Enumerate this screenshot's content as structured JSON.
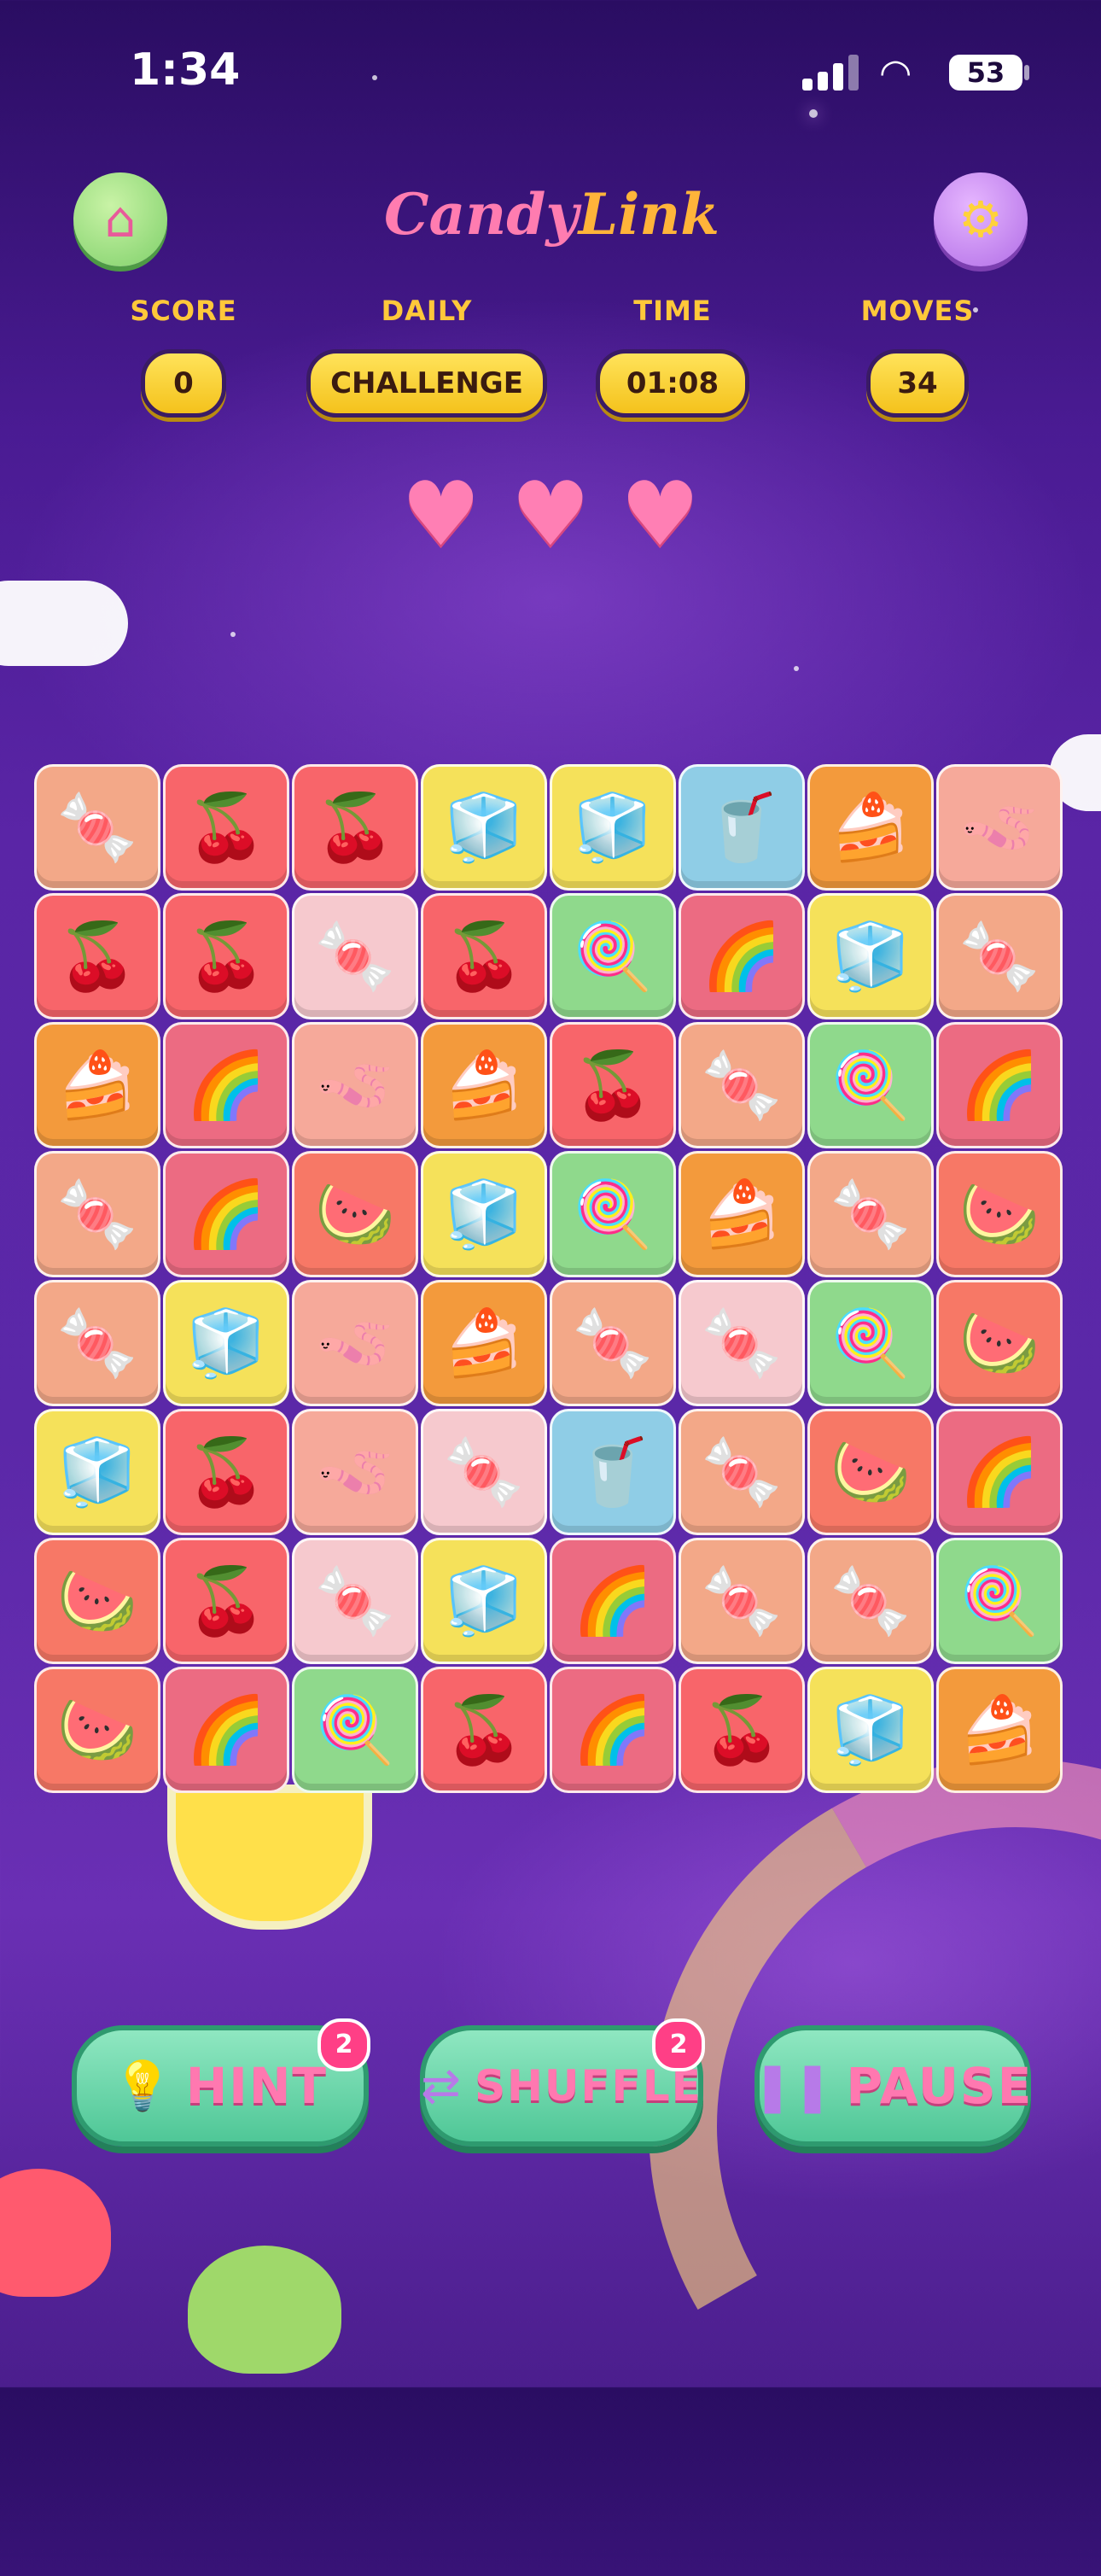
{
  "status_bar": {
    "time": "1:34",
    "battery": "53"
  },
  "header": {
    "logo_part1": "Candy",
    "logo_part2": "Link",
    "home_icon": "house-icon",
    "settings_icon": "gear-icon"
  },
  "stats": {
    "score_label": "SCORE",
    "score_value": "0",
    "daily_label": "DAILY",
    "daily_value": "CHALLENGE",
    "time_label": "TIME",
    "time_value": "01:08",
    "moves_label": "MOVES",
    "moves_value": "34"
  },
  "lives": 3,
  "board": {
    "columns": 8,
    "rows": [
      [
        "macaron",
        "cherry",
        "cherry",
        "jelly",
        "jelly",
        "cola",
        "cake",
        "worm"
      ],
      [
        "cherry",
        "cherry",
        "candy",
        "cherry",
        "cane",
        "rainbow",
        "jelly",
        "macaron"
      ],
      [
        "cake",
        "rainbow",
        "worm",
        "cake",
        "cherry",
        "macaron",
        "cane",
        "rainbow"
      ],
      [
        "macaron",
        "rainbow",
        "melon",
        "jelly",
        "cane",
        "cake",
        "macaron",
        "melon"
      ],
      [
        "macaron",
        "jelly",
        "worm",
        "cake",
        "macaron",
        "candy",
        "cane",
        "melon"
      ],
      [
        "jelly",
        "cherry",
        "worm",
        "candy",
        "cola",
        "macaron",
        "melon",
        "rainbow"
      ],
      [
        "melon",
        "cherry",
        "candy",
        "jelly",
        "rainbow",
        "macaron",
        "macaron",
        "cane"
      ],
      [
        "melon",
        "rainbow",
        "cane",
        "cherry",
        "rainbow",
        "cherry",
        "jelly",
        "cake"
      ]
    ]
  },
  "tile_icons": {
    "cherry": "🍒",
    "macaron": "🍬",
    "jelly": "🧊",
    "cola": "🥤",
    "cake": "🍰",
    "worm": "🪱",
    "cane": "🍭",
    "rainbow": "🌈",
    "candy": "🍬",
    "melon": "🍉"
  },
  "buttons": {
    "hint_label": "HINT",
    "hint_badge": "2",
    "hint_icon": "lightbulb-icon",
    "shuffle_label": "SHUFFLE",
    "shuffle_badge": "2",
    "shuffle_icon": "shuffle-icon",
    "pause_label": "PAUSE",
    "pause_icon": "pause-icon"
  }
}
